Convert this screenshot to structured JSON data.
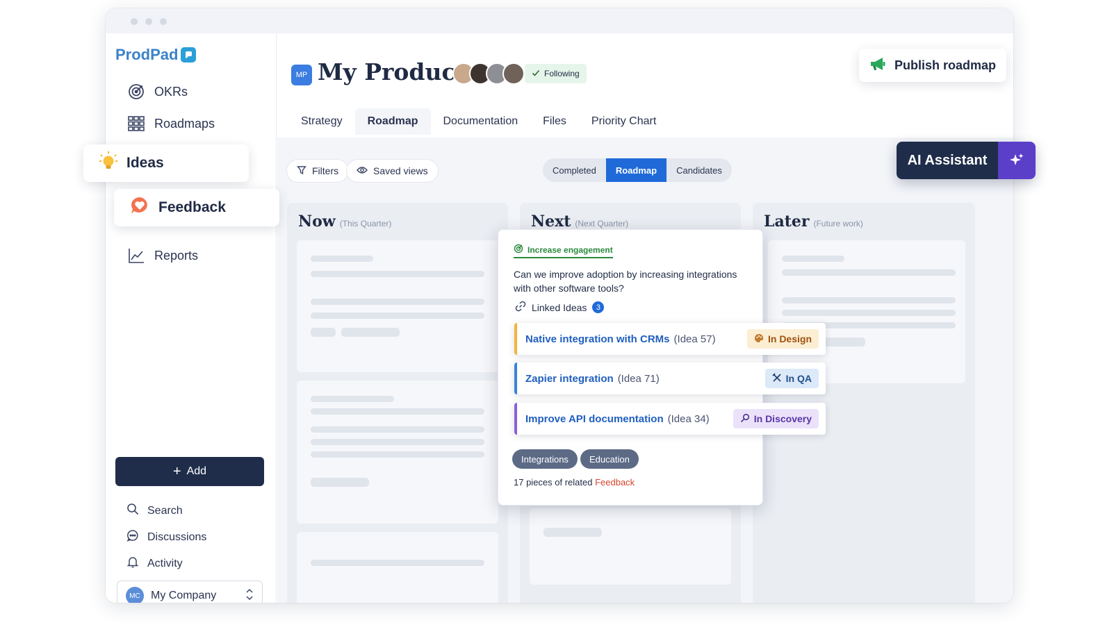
{
  "brand": {
    "name": "ProdPad"
  },
  "sidebar": {
    "items": [
      {
        "label": "OKRs",
        "icon": "target-icon"
      },
      {
        "label": "Roadmaps",
        "icon": "grid-icon"
      },
      {
        "label": "Ideas",
        "icon": "lightbulb-icon"
      },
      {
        "label": "Feedback",
        "icon": "heart-chat-icon"
      },
      {
        "label": "Reports",
        "icon": "line-chart-icon"
      }
    ],
    "add_label": "Add",
    "links": [
      {
        "label": "Search",
        "icon": "search-icon"
      },
      {
        "label": "Discussions",
        "icon": "chat-icon"
      },
      {
        "label": "Activity",
        "icon": "bell-icon"
      }
    ],
    "company": {
      "initials": "MC",
      "name": "My Company"
    }
  },
  "header": {
    "badge": "MP",
    "title": "My Product",
    "following_label": "Following",
    "publish_label": "Publish roadmap",
    "tabs": [
      "Strategy",
      "Roadmap",
      "Documentation",
      "Files",
      "Priority Chart"
    ],
    "active_tab": "Roadmap"
  },
  "toolbar": {
    "filters_label": "Filters",
    "saved_views_label": "Saved views",
    "segments": [
      "Completed",
      "Roadmap",
      "Candidates"
    ],
    "active_segment": "Roadmap",
    "ai_label": "AI Assistant"
  },
  "columns": [
    {
      "title": "Now",
      "subtitle": "(This Quarter)"
    },
    {
      "title": "Next",
      "subtitle": "(Next Quarter)"
    },
    {
      "title": "Later",
      "subtitle": "(Future work)"
    }
  ],
  "popup": {
    "objective": "Increase engagement",
    "question": "Can we improve adoption by increasing integrations with other software tools?",
    "linked_label": "Linked Ideas",
    "linked_count": "3",
    "ideas": [
      {
        "name": "Native integration with CRMs",
        "id": "(Idea 57)",
        "status": "In Design",
        "status_icon": "palette-icon"
      },
      {
        "name": "Zapier integration",
        "id": "(Idea 71)",
        "status": "In QA",
        "status_icon": "tools-icon"
      },
      {
        "name": "Improve API documentation",
        "id": "(Idea 34)",
        "status": "In Discovery",
        "status_icon": "magnifier-icon"
      }
    ],
    "tags": [
      "Integrations",
      "Education"
    ],
    "related_count": "17 pieces",
    "related_mid": " of related ",
    "related_link": "Feedback"
  },
  "colors": {
    "accent": "#1f6ad8",
    "navy": "#1f2d4a",
    "ai_purple": "#5b3fc8",
    "design_stripe": "#f0b43c",
    "qa_stripe": "#3a82d9",
    "discovery_stripe": "#8a5fd6",
    "feedback_red": "#d6452c",
    "okr_green": "#2a8a3e"
  }
}
